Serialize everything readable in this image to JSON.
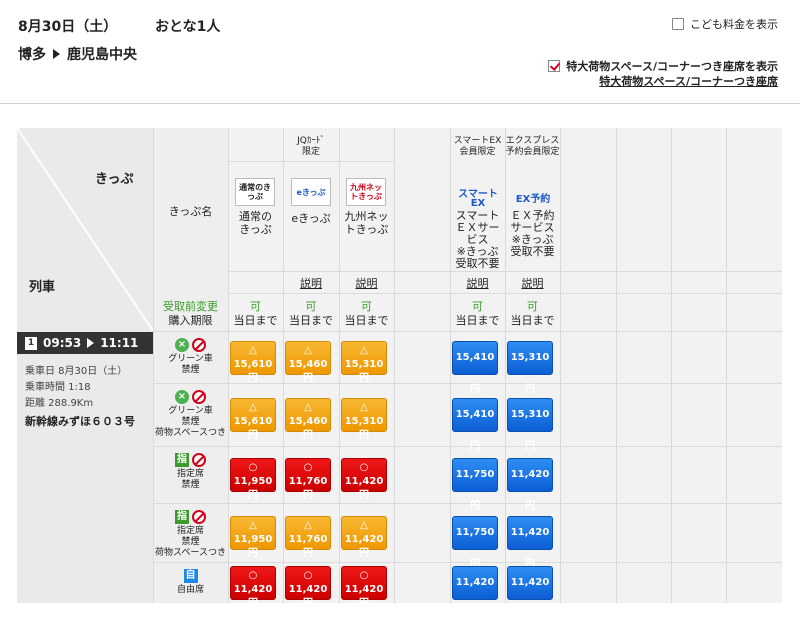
{
  "header": {
    "date": "8月30日（土）",
    "passengers": "おとな1人",
    "from": "博多",
    "to": "鹿児島中央",
    "child_fare_label": "こども料金を表示",
    "oversize_label": "特大荷物スペース/コーナーつき座席を表示",
    "oversize_link": "特大荷物スペース/コーナーつき座席"
  },
  "table": {
    "kippu_header": "きっぷ",
    "train_header": "列車",
    "kippu_name_label": "きっぷ名",
    "change_label": "受取前変更",
    "limit_label": "購入期限",
    "tickets": [
      {
        "id": "normal",
        "logo": "通常のきっぷ",
        "name_l1": "通常の",
        "name_l2": "きっぷ",
        "note_top": "",
        "explain": "",
        "change": "可",
        "limit": "当日まで"
      },
      {
        "id": "e",
        "logo": "eきっぷ",
        "name_l1": "eきっぷ",
        "name_l2": "",
        "note_top": "JQｶｰﾄﾞ限定",
        "note_l1": "JQｶｰﾄﾞ",
        "note_l2": "限定",
        "explain": "説明",
        "change": "可",
        "limit": "当日まで"
      },
      {
        "id": "kyushu",
        "logo": "九州ネットきっぷ",
        "name_l1": "九州ネッ",
        "name_l2": "トきっぷ",
        "note_top": "",
        "explain": "説明",
        "change": "可",
        "limit": "当日まで"
      },
      {
        "id": "smartex",
        "logo": "スマートEX",
        "name_l1": "スマート",
        "name_l2": "ＥＸサー",
        "name_l3": "ビス",
        "name_l4": "※きっぷ",
        "name_l5": "受取不要",
        "note_l1": "スマートEX",
        "note_l2": "会員限定",
        "explain": "説明",
        "change": "可",
        "limit": "当日まで"
      },
      {
        "id": "ex",
        "logo": "EX予約",
        "name_l1": "ＥＸ予約",
        "name_l2": "サービス",
        "name_l3": "※きっぷ",
        "name_l4": "受取不要",
        "note_l1": "エクスプレス",
        "note_l2": "予約会員限定",
        "explain": "説明",
        "change": "可",
        "limit": "当日まで"
      }
    ]
  },
  "train": {
    "number": "1",
    "depart": "09:53",
    "arrive": "11:11",
    "date_line": "乗車日 8月30日（土）",
    "time_line": "乗車時間 1:18",
    "dist_line": "距離 288.9Km",
    "name": "新幹線みずほ６０３号"
  },
  "seat_rows": [
    {
      "icon": "×",
      "icon_color": "#4caf50",
      "l1": "グリーン車",
      "l2": "禁煙",
      "l3": "",
      "prices": [
        {
          "sym": "△",
          "p": "15,610円",
          "c": "orange"
        },
        {
          "sym": "△",
          "p": "15,460円",
          "c": "orange"
        },
        {
          "sym": "△",
          "p": "15,310円",
          "c": "orange"
        },
        {
          "sym": "",
          "p": "15,410円",
          "c": "blue"
        },
        {
          "sym": "",
          "p": "15,310円",
          "c": "blue"
        }
      ]
    },
    {
      "icon": "×",
      "icon_color": "#4caf50",
      "l1": "グリーン車",
      "l2": "禁煙",
      "l3": "荷物スペースつき",
      "prices": [
        {
          "sym": "△",
          "p": "15,610円",
          "c": "orange"
        },
        {
          "sym": "△",
          "p": "15,460円",
          "c": "orange"
        },
        {
          "sym": "△",
          "p": "15,310円",
          "c": "orange"
        },
        {
          "sym": "",
          "p": "15,410円",
          "c": "blue"
        },
        {
          "sym": "",
          "p": "15,310円",
          "c": "blue"
        }
      ]
    },
    {
      "icon": "指",
      "icon_color": "#3c9a2c",
      "l1": "指定席",
      "l2": "禁煙",
      "l3": "",
      "prices": [
        {
          "sym": "○",
          "p": "11,950円",
          "c": "red"
        },
        {
          "sym": "○",
          "p": "11,760円",
          "c": "red"
        },
        {
          "sym": "○",
          "p": "11,420円",
          "c": "red"
        },
        {
          "sym": "",
          "p": "11,750円",
          "c": "blue"
        },
        {
          "sym": "",
          "p": "11,420円",
          "c": "blue"
        }
      ]
    },
    {
      "icon": "指",
      "icon_color": "#3c9a2c",
      "l1": "指定席",
      "l2": "禁煙",
      "l3": "荷物スペースつき",
      "prices": [
        {
          "sym": "△",
          "p": "11,950円",
          "c": "orange"
        },
        {
          "sym": "△",
          "p": "11,760円",
          "c": "orange"
        },
        {
          "sym": "△",
          "p": "11,420円",
          "c": "orange"
        },
        {
          "sym": "",
          "p": "11,750円",
          "c": "blue"
        },
        {
          "sym": "",
          "p": "11,420円",
          "c": "blue"
        }
      ]
    },
    {
      "icon": "自",
      "icon_color": "#1e88e5",
      "l1": "自由席",
      "l2": "",
      "l3": "",
      "prices": [
        {
          "sym": "○",
          "p": "11,420円",
          "c": "red"
        },
        {
          "sym": "○",
          "p": "11,420円",
          "c": "red"
        },
        {
          "sym": "○",
          "p": "11,420円",
          "c": "red"
        },
        {
          "sym": "",
          "p": "11,420円",
          "c": "blue"
        },
        {
          "sym": "",
          "p": "11,420円",
          "c": "blue"
        }
      ]
    }
  ]
}
